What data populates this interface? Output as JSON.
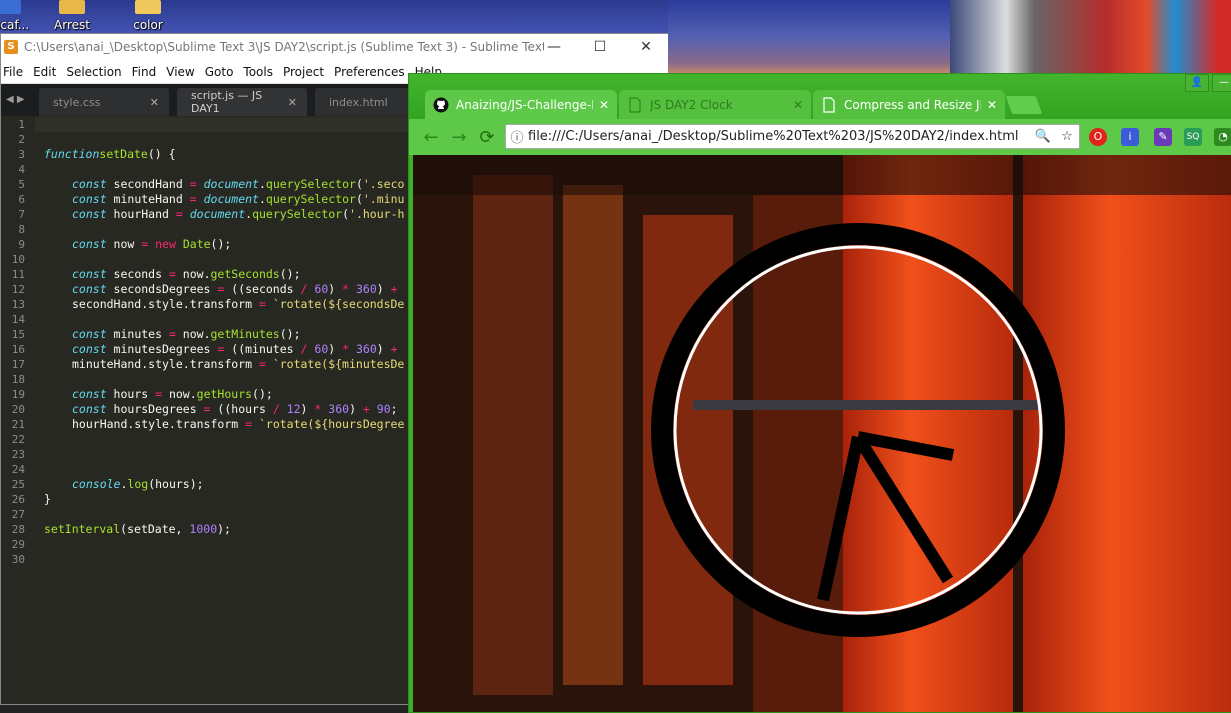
{
  "desktop": {
    "icons": [
      {
        "label": "oscaf...",
        "icon": "app-icon"
      },
      {
        "label": "Arrest",
        "icon": "folder-icon"
      },
      {
        "label": "color",
        "icon": "folder-icon"
      }
    ]
  },
  "sublime": {
    "title": "C:\\Users\\anai_\\Desktop\\Sublime Text 3\\JS DAY2\\script.js (Sublime Text 3) - Sublime Text (UNR...",
    "app_icon_glyph": "S",
    "window_controls": {
      "minimize": "—",
      "maximize": "☐",
      "close": "✕"
    },
    "menu": [
      "File",
      "Edit",
      "Selection",
      "Find",
      "View",
      "Goto",
      "Tools",
      "Project",
      "Preferences",
      "Help"
    ],
    "tab_nav": "◀ ▶",
    "tabs": [
      {
        "label": "style.css",
        "close": "✕"
      },
      {
        "label": "script.js — JS DAY1",
        "close": "✕"
      },
      {
        "label": "index.html",
        "close": "✕"
      }
    ],
    "line_numbers": [
      "1",
      "2",
      "3",
      "4",
      "5",
      "6",
      "7",
      "8",
      "9",
      "10",
      "11",
      "12",
      "13",
      "14",
      "15",
      "16",
      "17",
      "18",
      "19",
      "20",
      "21",
      "22",
      "23",
      "24",
      "25",
      "26",
      "27",
      "28",
      "29",
      "30"
    ],
    "code": {
      "l3": [
        "function",
        "setDate",
        "() {"
      ],
      "l5": [
        "const",
        " secondHand ",
        "=",
        " ",
        "document",
        ".",
        "querySelector",
        "(",
        "'.seco"
      ],
      "l6": [
        "const",
        " minuteHand ",
        "=",
        " ",
        "document",
        ".",
        "querySelector",
        "(",
        "'.minu"
      ],
      "l7": [
        "const",
        " hourHand ",
        "=",
        " ",
        "document",
        ".",
        "querySelector",
        "(",
        "'.hour-h"
      ],
      "l9": [
        "const",
        " now ",
        "=",
        " ",
        "new",
        " ",
        "Date",
        "();"
      ],
      "l11": [
        "const",
        " seconds ",
        "=",
        " now.",
        "getSeconds",
        "();"
      ],
      "l12": [
        "const",
        " secondsDegrees ",
        "=",
        " ((seconds ",
        "/",
        " ",
        "60",
        ") ",
        "*",
        " ",
        "360",
        ") ",
        "+"
      ],
      "l13": [
        "secondHand.style.transform ",
        "=",
        " ",
        "`rotate(${secondsDe"
      ],
      "l15": [
        "const",
        " minutes ",
        "=",
        " now.",
        "getMinutes",
        "();"
      ],
      "l16": [
        "const",
        " minutesDegrees ",
        "=",
        " ((minutes ",
        "/",
        " ",
        "60",
        ") ",
        "*",
        " ",
        "360",
        ") ",
        "+"
      ],
      "l17": [
        "minuteHand.style.transform ",
        "=",
        " ",
        "`rotate(${minutesDe"
      ],
      "l19": [
        "const",
        " hours ",
        "=",
        " now.",
        "getHours",
        "();"
      ],
      "l20": [
        "const",
        " hoursDegrees ",
        "=",
        " ((hours ",
        "/",
        " ",
        "12",
        ") ",
        "*",
        " ",
        "360",
        ") ",
        "+",
        " ",
        "90",
        ";"
      ],
      "l21": [
        "hourHand.style.transform ",
        "=",
        " ",
        "`rotate(${hoursDegree"
      ],
      "l25": [
        "console",
        ".",
        "log",
        "(hours);"
      ],
      "l26": "}",
      "l28": [
        "setInterval",
        "(setDate, ",
        "1000",
        ");"
      ]
    }
  },
  "chrome": {
    "tabs": [
      {
        "label": "Anaizing/JS-Challenge-D",
        "icon": "github-icon",
        "close": "✕"
      },
      {
        "label": "JS DAY2 Clock",
        "icon": "page-icon",
        "close": "✕"
      },
      {
        "label": "Compress and Resize JPE",
        "icon": "page-icon",
        "close": "✕"
      }
    ],
    "url": "file:///C:/Users/anai_/Desktop/Sublime%20Text%203/JS%20DAY2/index.html",
    "nav": {
      "back": "←",
      "forward": "→",
      "reload": "⟳",
      "info": "ⓘ",
      "zoom": "🔍",
      "star": "☆"
    },
    "window_controls": {
      "profile": "👤",
      "minimize": "—"
    },
    "extensions": [
      "opera-icon",
      "translate-icon",
      "color-picker-icon",
      "sq-icon",
      "speedometer-icon"
    ],
    "extension_labels": {
      "sq": "SQ"
    }
  }
}
